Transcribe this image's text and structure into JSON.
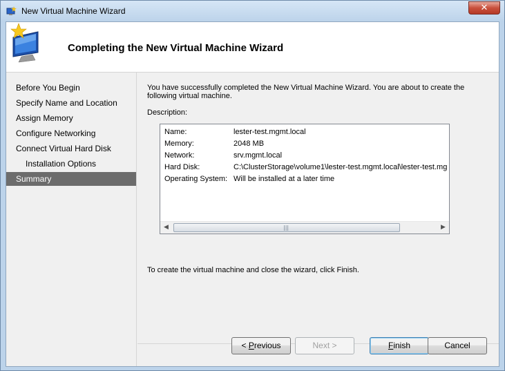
{
  "window": {
    "title": "New Virtual Machine Wizard",
    "close_label": "✕"
  },
  "header": {
    "title": "Completing the New Virtual Machine Wizard"
  },
  "nav": {
    "items": [
      {
        "label": "Before You Begin"
      },
      {
        "label": "Specify Name and Location"
      },
      {
        "label": "Assign Memory"
      },
      {
        "label": "Configure Networking"
      },
      {
        "label": "Connect Virtual Hard Disk"
      },
      {
        "label": "Installation Options"
      },
      {
        "label": "Summary"
      }
    ],
    "selected": "Summary"
  },
  "main": {
    "intro": "You have successfully completed the New Virtual Machine Wizard. You are about to create the following virtual machine.",
    "description_label": "Description:",
    "summary": [
      {
        "key": "Name:",
        "value": "lester-test.mgmt.local"
      },
      {
        "key": "Memory:",
        "value": "2048 MB"
      },
      {
        "key": "Network:",
        "value": "srv.mgmt.local"
      },
      {
        "key": "Hard Disk:",
        "value": "C:\\ClusterStorage\\volume1\\lester-test.mgmt.local\\lester-test.mg"
      },
      {
        "key": "Operating System:",
        "value": "Will be installed at a later time"
      }
    ],
    "finish_note": "To create the virtual machine and close the wizard, click Finish."
  },
  "buttons": {
    "previous_pre": "< ",
    "previous_accel": "P",
    "previous_post": "revious",
    "next": "Next >",
    "finish_accel": "F",
    "finish_post": "inish",
    "cancel": "Cancel"
  },
  "colors": {
    "selected_nav_bg": "#6c6c6c",
    "titlebar": "#bcd3ea"
  }
}
